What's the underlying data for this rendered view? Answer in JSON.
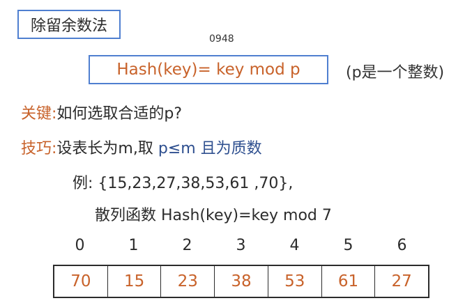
{
  "title": "除留余数法",
  "code_label": "0948",
  "formula": "Hash(key)=  key  mod  p",
  "formula_note": "(p是一个整数)",
  "key_point": {
    "label": "关键:",
    "text": "如何选取合适的p?"
  },
  "tip": {
    "label": "技巧:",
    "text_dark": "设表长为m,取",
    "text_blue": "p≤m 且为质数"
  },
  "example": {
    "label": "例:",
    "set": "{15,23,27,38,53,61 ,70},"
  },
  "hash_function": "散列函数 Hash(key)=key mod 7",
  "indices": [
    "0",
    "1",
    "2",
    "3",
    "4",
    "5",
    "6"
  ],
  "cells": [
    "70",
    "15",
    "23",
    "38",
    "53",
    "61",
    "27"
  ],
  "colors": {
    "accent_orange": "#c8622a",
    "accent_blue": "#2e4f8f",
    "box_border": "#4f7fd0"
  }
}
